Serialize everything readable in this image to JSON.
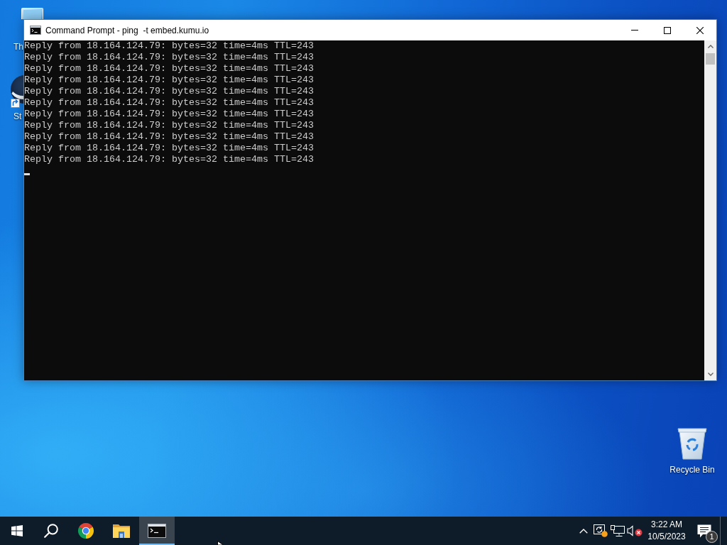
{
  "desktop_icons": [
    {
      "kind": "computer",
      "label": "Th"
    },
    {
      "kind": "app_shortcut",
      "label": "St"
    }
  ],
  "window": {
    "title": "Command Prompt - ping  -t embed.kumu.io",
    "lines": [
      "Reply from 18.164.124.79: bytes=32 time=4ms TTL=243",
      "Reply from 18.164.124.79: bytes=32 time=4ms TTL=243",
      "Reply from 18.164.124.79: bytes=32 time=4ms TTL=243",
      "Reply from 18.164.124.79: bytes=32 time=4ms TTL=243",
      "Reply from 18.164.124.79: bytes=32 time=4ms TTL=243",
      "Reply from 18.164.124.79: bytes=32 time=4ms TTL=243",
      "Reply from 18.164.124.79: bytes=32 time=4ms TTL=243",
      "Reply from 18.164.124.79: bytes=32 time=4ms TTL=243",
      "Reply from 18.164.124.79: bytes=32 time=4ms TTL=243",
      "Reply from 18.164.124.79: bytes=32 time=4ms TTL=243",
      "Reply from 18.164.124.79: bytes=32 time=4ms TTL=243"
    ],
    "cursor": true
  },
  "recycle_bin": {
    "label": "Recycle Bin"
  },
  "taskbar": {
    "buttons": [
      {
        "kind": "start",
        "selected": false
      },
      {
        "kind": "search",
        "selected": false
      },
      {
        "kind": "browser",
        "selected": false
      },
      {
        "kind": "folder",
        "selected": false
      },
      {
        "kind": "terminal",
        "selected": true
      }
    ],
    "tray_icons": [
      {
        "kind": "chevron"
      },
      {
        "kind": "sync_alert"
      },
      {
        "kind": "network"
      }
    ],
    "volume": {
      "muted": true
    },
    "clock": {
      "time": "3:22 AM",
      "date": "10/5/2023"
    },
    "notifications": {
      "count": "1"
    }
  }
}
